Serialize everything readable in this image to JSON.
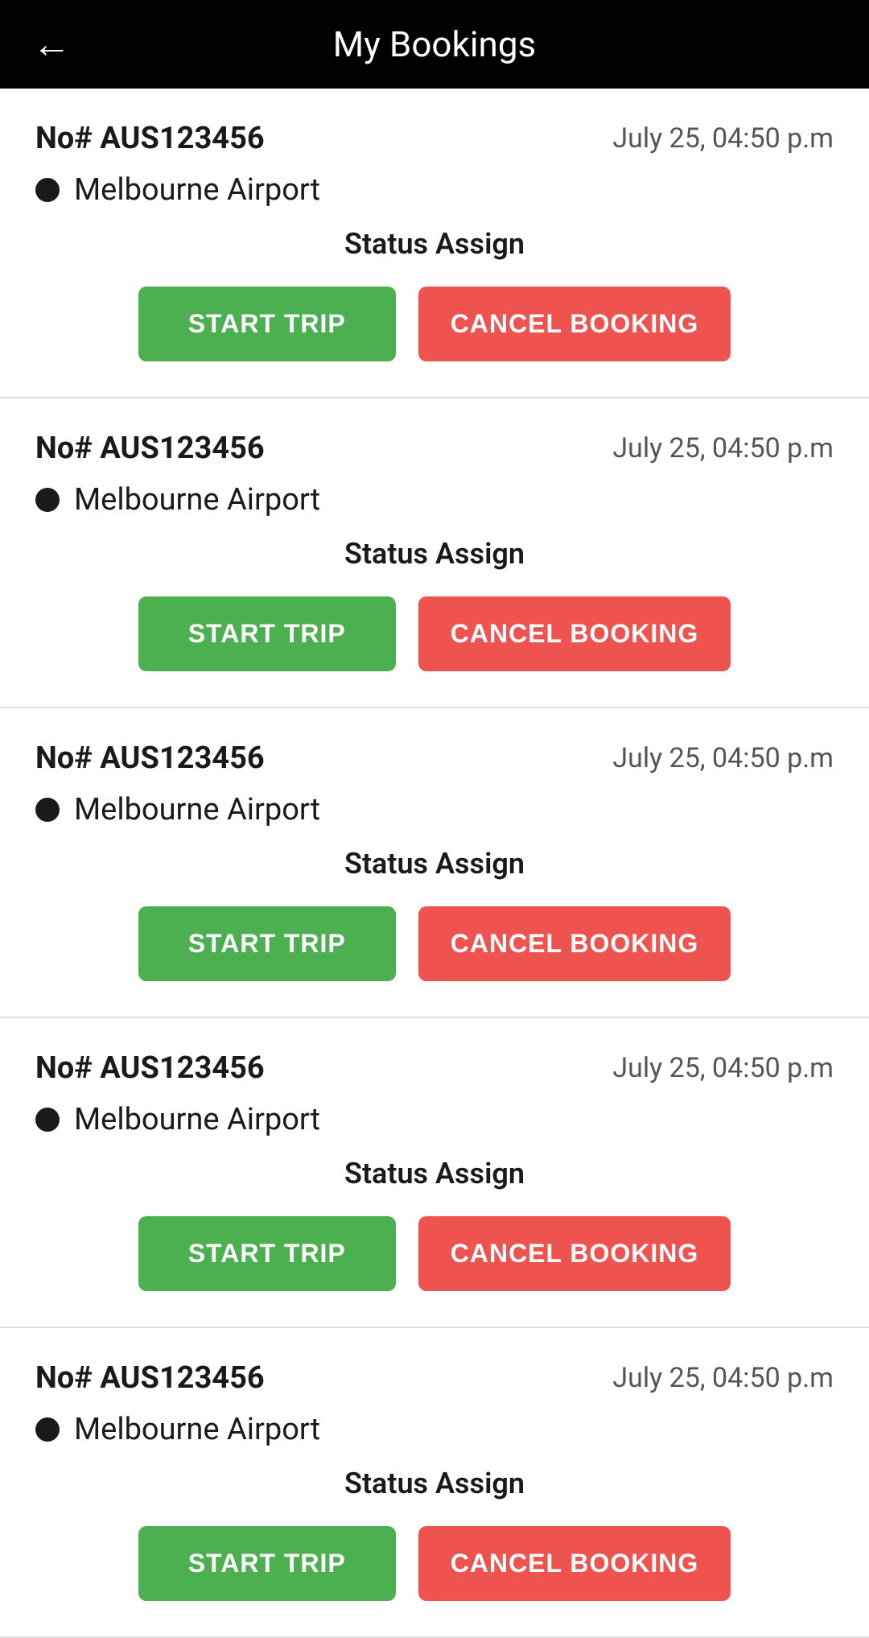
{
  "header": {
    "title": "My Bookings",
    "back_icon": "←"
  },
  "bookings": [
    {
      "id": "booking-1",
      "number": "No# AUS123456",
      "date": "July 25, 04:50 p.m",
      "location": "Melbourne Airport",
      "status": "Status Assign",
      "start_trip_label": "START TRIP",
      "cancel_booking_label": "CANCEL BOOKING"
    },
    {
      "id": "booking-2",
      "number": "No# AUS123456",
      "date": "July 25, 04:50 p.m",
      "location": "Melbourne Airport",
      "status": "Status Assign",
      "start_trip_label": "START TRIP",
      "cancel_booking_label": "CANCEL BOOKING"
    },
    {
      "id": "booking-3",
      "number": "No# AUS123456",
      "date": "July 25, 04:50 p.m",
      "location": "Melbourne Airport",
      "status": "Status Assign",
      "start_trip_label": "START TRIP",
      "cancel_booking_label": "CANCEL BOOKING"
    },
    {
      "id": "booking-4",
      "number": "No# AUS123456",
      "date": "July 25, 04:50 p.m",
      "location": "Melbourne Airport",
      "status": "Status Assign",
      "start_trip_label": "START TRIP",
      "cancel_booking_label": "CANCEL BOOKING"
    },
    {
      "id": "booking-5",
      "number": "No# AUS123456",
      "date": "July 25, 04:50 p.m",
      "location": "Melbourne Airport",
      "status": "Status Assign",
      "start_trip_label": "START TRIP",
      "cancel_booking_label": "CANCEL BOOKING"
    }
  ],
  "colors": {
    "header_bg": "#000000",
    "start_trip_bg": "#4caf50",
    "cancel_booking_bg": "#ef5350"
  }
}
